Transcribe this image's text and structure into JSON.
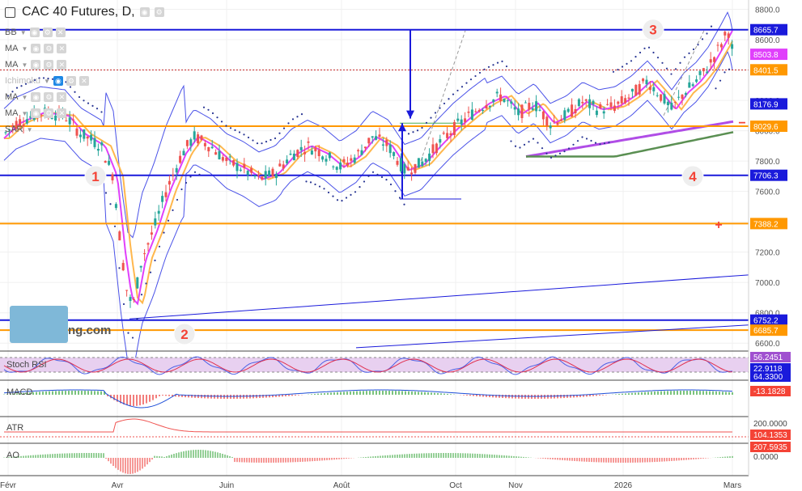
{
  "header": {
    "title": "CAC 40 Futures, D,"
  },
  "indicators": [
    {
      "label": "BB"
    },
    {
      "label": "MA"
    },
    {
      "label": "MA"
    },
    {
      "label": "Ichimoku"
    },
    {
      "label": "MA"
    },
    {
      "label": "MA"
    },
    {
      "label": "SAR"
    }
  ],
  "colors": {
    "up": "#26a69a",
    "down": "#ef5350",
    "blue_line": "#1a1adb",
    "orange_line": "#ff9800",
    "bollinger": "#4a52e8",
    "ma_pink": "#e040fb",
    "ma_orange": "#ffb74d",
    "ma_purple": "#b04de6",
    "ma_green": "#5a8f52",
    "red_label": "#f44336",
    "stoch_bg": "#e8d0f0",
    "stoch_k": "#4c61e6",
    "stoch_d": "#e03050"
  },
  "chart_data": {
    "type": "candlestick",
    "title": "CAC 40 Futures, D,",
    "x_ticks": [
      "Févr",
      "Avr",
      "Juin",
      "Août",
      "Oct",
      "Nov",
      "2026",
      "Mars"
    ],
    "y_ticks": [
      6600,
      6800,
      7000,
      7200,
      7400,
      7600,
      7800,
      8000,
      8200,
      8400,
      8600,
      8800
    ],
    "y_range": [
      6580,
      8840
    ],
    "price_labels": [
      {
        "value": "8665.7",
        "color": "blue"
      },
      {
        "value": "8503.8",
        "color": "purple"
      },
      {
        "value": "8401.5",
        "color": "orange"
      },
      {
        "value": "8176.9",
        "color": "blue"
      },
      {
        "value": "8029.6",
        "color": "orange"
      },
      {
        "value": "7706.3",
        "color": "blue"
      },
      {
        "value": "7388.2",
        "color": "orange"
      },
      {
        "value": "6752.2",
        "color": "blue"
      },
      {
        "value": "6685.7",
        "color": "orange"
      }
    ],
    "horizontal_levels": [
      {
        "value": 8665.7,
        "color": "blue"
      },
      {
        "value": 8029.6,
        "color": "orange"
      },
      {
        "value": 7706.3,
        "color": "blue"
      },
      {
        "value": 7388.2,
        "color": "orange"
      },
      {
        "value": 6752.2,
        "color": "blue"
      },
      {
        "value": 6685.7,
        "color": "orange"
      }
    ],
    "annotations": [
      {
        "text": "1",
        "color": "red"
      },
      {
        "text": "2",
        "color": "red"
      },
      {
        "text": "3",
        "color": "red"
      },
      {
        "text": "4",
        "color": "red"
      },
      {
        "text": "+",
        "color": "red"
      },
      {
        "text": "−",
        "color": "red"
      }
    ],
    "subpanels": [
      {
        "name": "Stoch RSI",
        "labels": [
          "56.2451",
          "22.9118",
          "64.3300"
        ]
      },
      {
        "name": "MACD",
        "labels": [
          "-13.1828"
        ]
      },
      {
        "name": "ATR",
        "labels": [
          "200.0000",
          "104.1353"
        ]
      },
      {
        "name": "AO",
        "labels": [
          "207.5935",
          "0.0000"
        ]
      }
    ]
  }
}
